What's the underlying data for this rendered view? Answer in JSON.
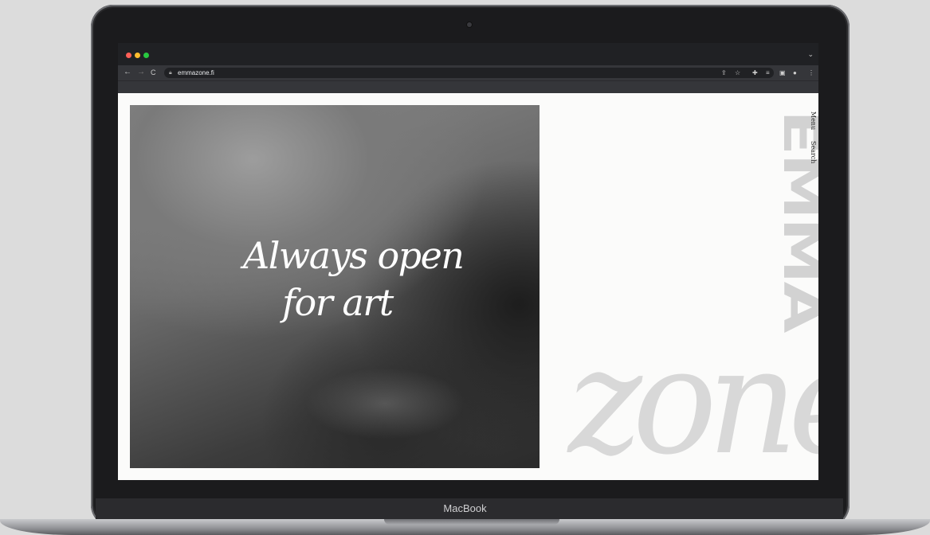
{
  "browser": {
    "url": "emmazone.fi",
    "nav": {
      "back": "←",
      "forward": "→",
      "reload": "C"
    },
    "toolbar_icons": [
      "share-icon",
      "star-icon",
      "extensions-icon",
      "reading-list-icon",
      "sidebar-icon",
      "profile-icon",
      "more-icon"
    ]
  },
  "page": {
    "hero": {
      "line1": "Always open",
      "line2": "for art"
    },
    "logo_vertical": "EMMA",
    "logo_zone": "zone",
    "side_nav": {
      "menu": "Menu",
      "search": "Search"
    }
  },
  "device": {
    "brand": "MacBook"
  },
  "colors": {
    "bezel": "#1b1b1d",
    "chrome_dark": "#202124",
    "chrome_toolbar": "#35363a",
    "page_bg": "#fbfbfa",
    "logo_grey": "#d2d2d2"
  }
}
